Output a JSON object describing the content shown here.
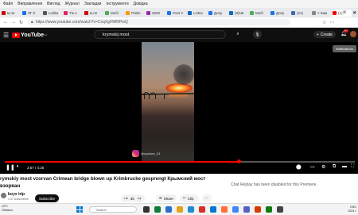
{
  "menubar": [
    "Файл",
    "Виправлення",
    "Вигляд",
    "Журнал",
    "Закладки",
    "Інструменти",
    "Довідка"
  ],
  "tabs": [
    {
      "label": "м.пе",
      "color": "#c00"
    },
    {
      "label": "ЛГ 0",
      "color": "#1a73e8"
    },
    {
      "label": "Lodka",
      "color": "#555"
    },
    {
      "label": "Тік н",
      "color": "#e91e63"
    },
    {
      "label": "м.пе",
      "color": "#c00"
    },
    {
      "label": "Мобі",
      "color": "#4caf50"
    },
    {
      "label": "Publo",
      "color": "#ff9800"
    },
    {
      "label": "2500",
      "color": "#9c27b0"
    },
    {
      "label": "Post V",
      "color": "#1a73e8"
    },
    {
      "label": "Linkto",
      "color": "#0a66c2"
    },
    {
      "label": "Допу",
      "color": "#1a73e8"
    },
    {
      "label": "(6)N5",
      "color": "#0a66c2"
    },
    {
      "label": "Мобі",
      "color": "#4caf50"
    },
    {
      "label": "Допу",
      "color": "#1a73e8"
    },
    {
      "label": "(21)",
      "color": "#4267b2"
    },
    {
      "label": "× Кам",
      "color": "#888"
    },
    {
      "label": "(1)",
      "color": "#ff0000",
      "active": true
    }
  ],
  "address": {
    "url": "https://www.youtube.com/watch?v=CxqXgHWRPwQ"
  },
  "youtube": {
    "logo_text": "YouTube",
    "logo_country": "UA",
    "search_query": "krymskij most",
    "create_label": "Create",
    "notif_count": "9+",
    "tooltip": "Notifications"
  },
  "video": {
    "overlay_handle": "@cyclone_24",
    "time_text": "2:57 / 4:25",
    "progress_fraction": 0.67
  },
  "title": "rymskiy most vzorvan Crimean bridge blown up Krimbrucke gesprengt Крымский мост взорван",
  "channel": {
    "name": "boys trip",
    "subscribers": "1.47 subscribers"
  },
  "actions": {
    "subscribe": "Subscribe",
    "likes": "35",
    "share": "Share",
    "clip": "Clip"
  },
  "chat_note": "Chat Replay has been disabled for this Premiere.",
  "taskbar": {
    "weather_temp": "13°C",
    "weather_desc": "Облачно",
    "search_placeholder": "Search",
    "tray_lang": "ENG",
    "tray_year": "2023 г."
  }
}
